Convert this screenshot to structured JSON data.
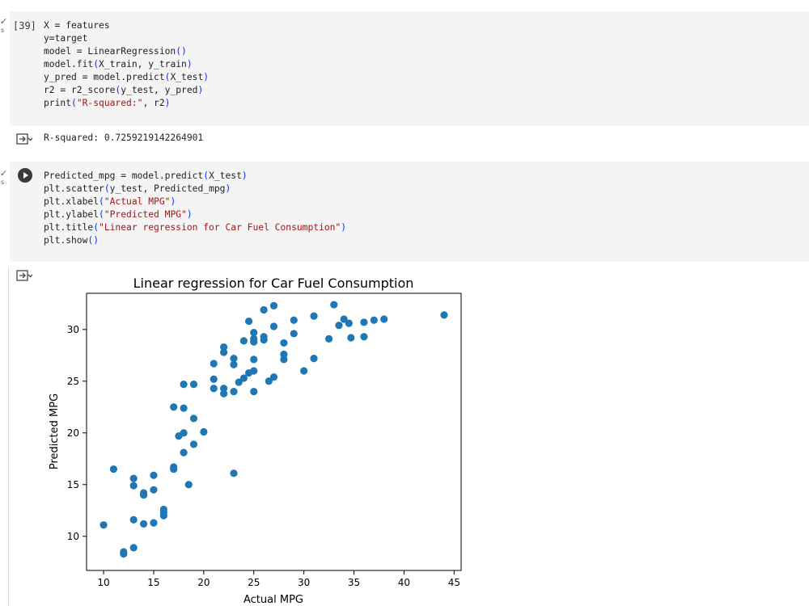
{
  "cells": [
    {
      "exec_count": "[39]",
      "status_mark": "✓",
      "status_letter": "s",
      "code_lines": [
        "X = features",
        "y=target",
        "model = LinearRegression()",
        "model.fit(X_train, y_train)",
        "y_pred = model.predict(X_test)",
        "r2 = r2_score(y_test, y_pred)",
        "print(\"R-squared:\", r2)"
      ],
      "output_text": "R-squared: 0.7259219142264901"
    },
    {
      "status_mark": "✓",
      "status_letter": "s",
      "code_lines": [
        "Predicted_mpg = model.predict(X_test)",
        "plt.scatter(y_test, Predicted_mpg)",
        "plt.xlabel(\"Actual MPG\")",
        "plt.ylabel(\"Predicted MPG\")",
        "plt.title(\"Linear regression for Car Fuel Consumption\")",
        "plt.show()"
      ]
    }
  ],
  "colors": {
    "point": "#1f77b4",
    "cell_bg": "#f4f4f4",
    "string": "#a31515",
    "paren": "#0431fa"
  },
  "icons": {
    "run": "play-circle-icon",
    "output": "output-expand-icon",
    "status": "check-icon"
  },
  "chart_data": {
    "type": "scatter",
    "title": "Linear regression for Car Fuel Consumption",
    "xlabel": "Actual MPG",
    "ylabel": "Predicted MPG",
    "xlim": [
      8.3,
      45.7
    ],
    "ylim": [
      6.7,
      33.5
    ],
    "xticks": [
      10,
      15,
      20,
      25,
      30,
      35,
      40,
      45
    ],
    "yticks": [
      10,
      15,
      20,
      25,
      30
    ],
    "grid": false,
    "points": [
      [
        10,
        11.1
      ],
      [
        11,
        16.5
      ],
      [
        12,
        8.5
      ],
      [
        12,
        8.3
      ],
      [
        13,
        8.9
      ],
      [
        13,
        11.6
      ],
      [
        13,
        14.9
      ],
      [
        13,
        15.6
      ],
      [
        14,
        11.2
      ],
      [
        14,
        14.0
      ],
      [
        14,
        14.2
      ],
      [
        15,
        11.3
      ],
      [
        15,
        14.5
      ],
      [
        15,
        15.9
      ],
      [
        16,
        12.0
      ],
      [
        16,
        12.3
      ],
      [
        16,
        12.6
      ],
      [
        17,
        16.5
      ],
      [
        17,
        16.7
      ],
      [
        17,
        22.5
      ],
      [
        17.5,
        19.7
      ],
      [
        18,
        18.1
      ],
      [
        18,
        20.0
      ],
      [
        18,
        22.4
      ],
      [
        18,
        24.7
      ],
      [
        18.5,
        15.0
      ],
      [
        19,
        18.9
      ],
      [
        19,
        21.4
      ],
      [
        19,
        24.7
      ],
      [
        20,
        20.1
      ],
      [
        21,
        24.3
      ],
      [
        21,
        25.2
      ],
      [
        21,
        26.7
      ],
      [
        22,
        23.8
      ],
      [
        22,
        24.3
      ],
      [
        22,
        27.8
      ],
      [
        22,
        28.3
      ],
      [
        23,
        16.1
      ],
      [
        23,
        24.0
      ],
      [
        23,
        26.6
      ],
      [
        23,
        27.2
      ],
      [
        23.5,
        24.9
      ],
      [
        24,
        25.3
      ],
      [
        24,
        28.9
      ],
      [
        24.5,
        25.8
      ],
      [
        24.5,
        30.8
      ],
      [
        25,
        24.0
      ],
      [
        25,
        26.0
      ],
      [
        25,
        27.1
      ],
      [
        25,
        28.8
      ],
      [
        25,
        29.1
      ],
      [
        25,
        29.7
      ],
      [
        26,
        29.0
      ],
      [
        26,
        29.3
      ],
      [
        26,
        31.9
      ],
      [
        26.5,
        25.0
      ],
      [
        27,
        25.4
      ],
      [
        27,
        30.3
      ],
      [
        27,
        32.3
      ],
      [
        28,
        27.1
      ],
      [
        28,
        27.6
      ],
      [
        28,
        28.7
      ],
      [
        29,
        29.6
      ],
      [
        29,
        30.9
      ],
      [
        30,
        26.0
      ],
      [
        31,
        27.2
      ],
      [
        31,
        31.3
      ],
      [
        32.5,
        29.1
      ],
      [
        33,
        32.4
      ],
      [
        33.5,
        30.4
      ],
      [
        34,
        31.0
      ],
      [
        34.5,
        30.6
      ],
      [
        34.7,
        29.2
      ],
      [
        36,
        29.3
      ],
      [
        36,
        30.7
      ],
      [
        37,
        30.9
      ],
      [
        38,
        31.0
      ],
      [
        44,
        31.4
      ]
    ]
  }
}
